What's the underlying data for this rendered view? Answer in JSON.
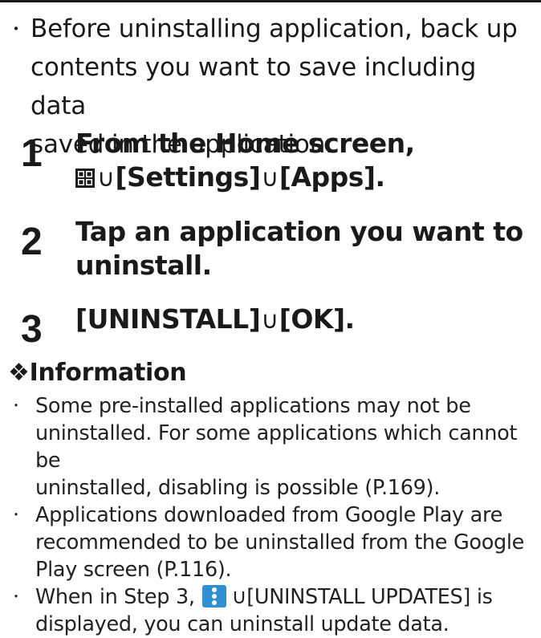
{
  "intro": {
    "bullet": "・",
    "text_line1": "Before uninstalling application, back up",
    "text_line2": "contents you want to save including data",
    "text_line3": "saved in the application."
  },
  "arrow": "∪",
  "steps": [
    {
      "number": "1",
      "line1": "From the Home screen,",
      "settings": "[Settings]",
      "apps": "[Apps]."
    },
    {
      "number": "2",
      "line1": "Tap an application you want to",
      "line2": "uninstall."
    },
    {
      "number": "3",
      "uninstall": "[UNINSTALL]",
      "ok": "[OK]."
    }
  ],
  "information": {
    "heading": "❖Information",
    "items": [
      {
        "bullet": "・",
        "line1": "Some pre-installed applications may not be",
        "line2": "uninstalled. For some applications which cannot be",
        "line3": "uninstalled, disabling is possible (P.169)."
      },
      {
        "bullet": "・",
        "line1": "Applications downloaded from Google Play are",
        "line2": "recommended to be uninstalled from the Google",
        "line3": "Play screen (P.116)."
      },
      {
        "bullet": "・",
        "prefix": "When in Step 3, ",
        "suffix": "[UNINSTALL UPDATES] is",
        "line2": "displayed, you can uninstall update data."
      }
    ]
  },
  "colors": {
    "text": "#1a1a1a",
    "kebab_icon_bg": "#2f8fd0"
  },
  "icons": {
    "apps_menu": "apps-grid-icon",
    "overflow_menu": "more-options-icon"
  }
}
